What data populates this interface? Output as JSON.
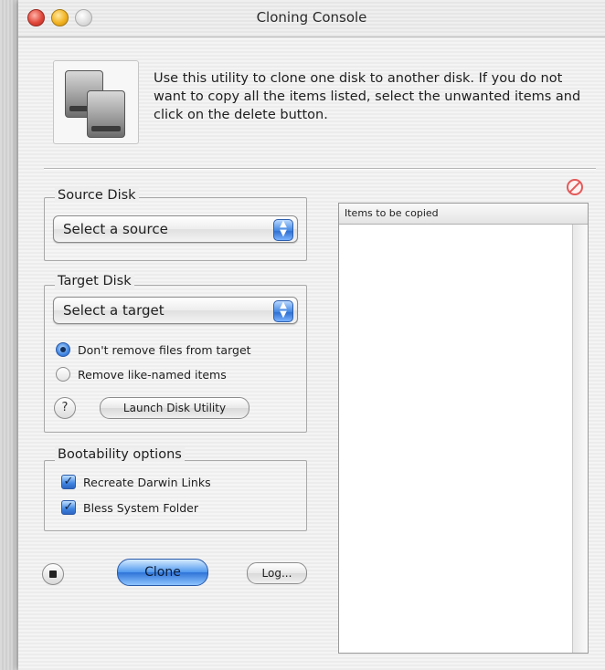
{
  "window": {
    "title": "Cloning Console"
  },
  "intro": {
    "text": "Use this utility to clone one disk to another disk.  If you do not want to copy all the items listed, select the unwanted items and click on the delete button."
  },
  "source": {
    "group_label": "Source Disk",
    "popup_value": "Select a source"
  },
  "target": {
    "group_label": "Target Disk",
    "popup_value": "Select a target",
    "radio_keep": "Don't remove files from target",
    "radio_remove": "Remove like-named items",
    "help": "?",
    "launch_button": "Launch Disk Utility"
  },
  "boot": {
    "group_label": "Bootability options",
    "recreate_links": "Recreate Darwin Links",
    "bless_folder": "Bless System Folder"
  },
  "actions": {
    "clone": "Clone",
    "log": "Log..."
  },
  "list": {
    "header": "Items to be copied"
  },
  "icons": {
    "disks": "hard-disks-icon",
    "delete": "delete-no-icon",
    "stop": "stop-icon",
    "popup_arrows": "up-down-arrows-icon"
  },
  "colors": {
    "accent": "#3d83e0",
    "close": "#e0473a",
    "minimize": "#f2b321",
    "delete": "#e35a5a"
  }
}
